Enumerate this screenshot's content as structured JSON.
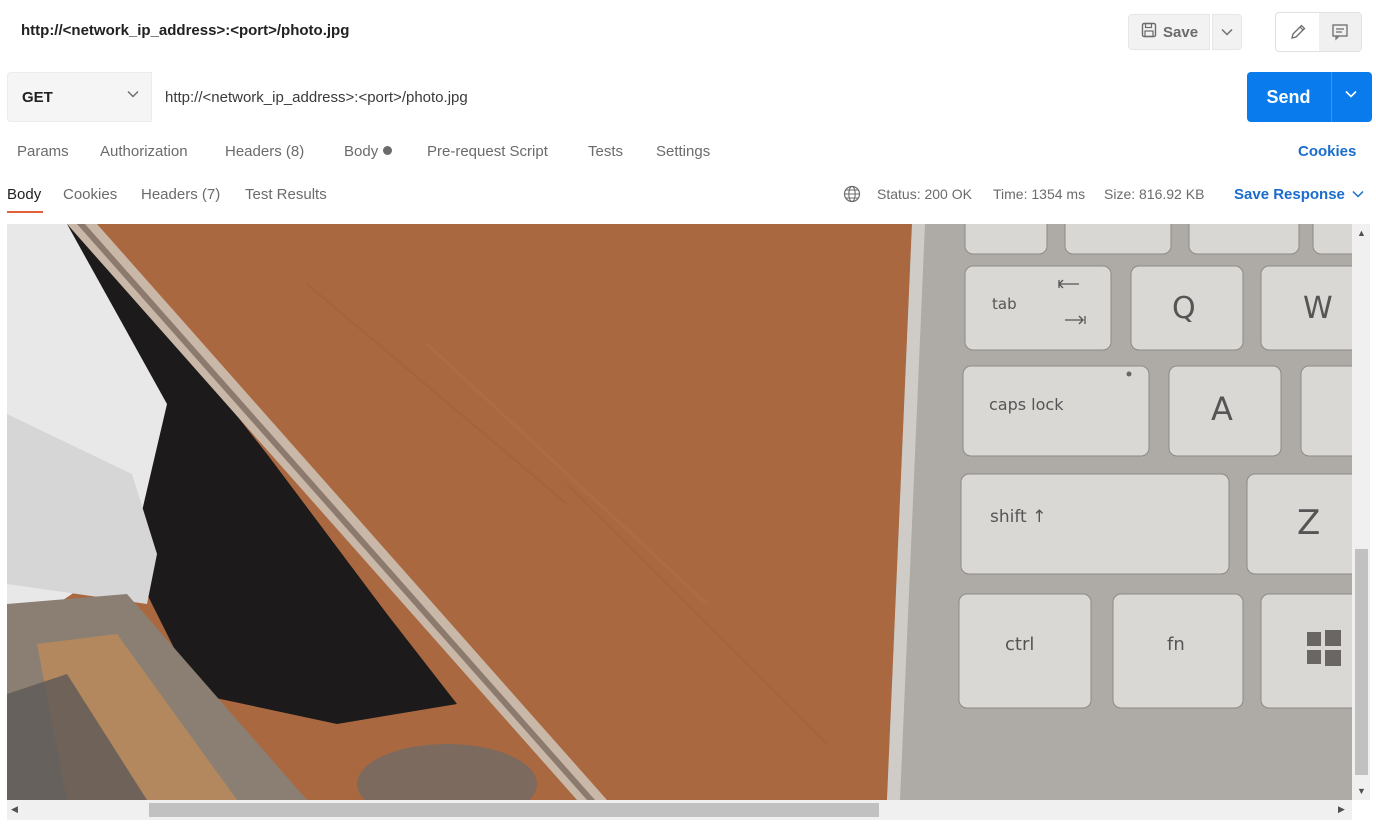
{
  "title_bar": {
    "title": "http://<network_ip_address>:<port>/photo.jpg",
    "save_label": "Save"
  },
  "request": {
    "method": "GET",
    "url": "http://<network_ip_address>:<port>/photo.jpg",
    "send_label": "Send"
  },
  "request_tabs": {
    "params": "Params",
    "authorization": "Authorization",
    "headers": "Headers (8)",
    "body": "Body",
    "prerequest": "Pre-request Script",
    "tests": "Tests",
    "settings": "Settings",
    "cookies": "Cookies"
  },
  "response": {
    "tabs": {
      "body": "Body",
      "cookies": "Cookies",
      "headers": "Headers (7)",
      "test_results": "Test Results"
    },
    "status_label": "Status:",
    "status_value": "200 OK",
    "time_label": "Time:",
    "time_value": "1354 ms",
    "size_label": "Size:",
    "size_value": "816.92 KB",
    "save_response": "Save Response"
  },
  "photo": {
    "keys": {
      "tab": "tab",
      "q": "Q",
      "w": "W",
      "caps": "caps lock",
      "a": "A",
      "shift": "shift ↑",
      "z": "Z",
      "ctrl": "ctrl",
      "fn": "fn"
    }
  },
  "colors": {
    "send": "#097bed",
    "link": "#1a6dcc",
    "active_tab_underline": "#e0603a",
    "desk": "#a9683f"
  },
  "scroll": {
    "vertical_position": 0.57,
    "horizontal_position": 0.11
  }
}
